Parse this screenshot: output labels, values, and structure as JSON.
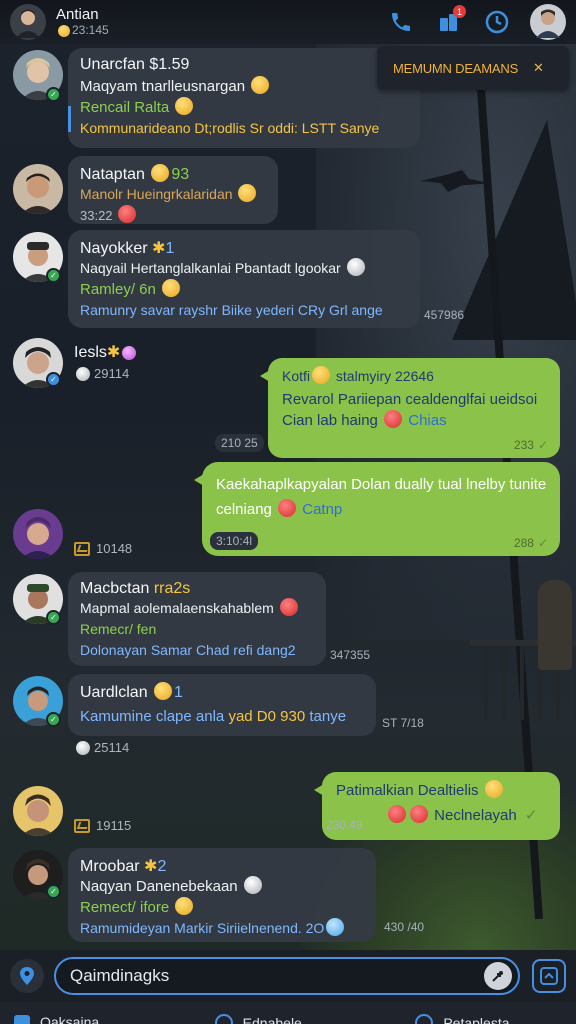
{
  "header": {
    "title": "Antian",
    "subtitle": "23:145",
    "notification_count": "1"
  },
  "banner": {
    "text": "MEMUMN DEAMANS"
  },
  "messages": [
    {
      "name": "Unarcfan $1.59",
      "lines": [
        "Maqyam tnarlleusnargan",
        "Rencail Ralta",
        "Kommunarideano Dt;rodlis Sr oddi: LSTT Sanye"
      ]
    },
    {
      "name": "Nataptan",
      "name_tag": "93",
      "lines": [
        "Manolr Hueingrkalaridan",
        "33:22"
      ]
    },
    {
      "name": "Nayokker",
      "name_tag": "1",
      "lines": [
        "Naqyail Hertanglalkanlai Pbantadt lgookar",
        "Ramley/ 6n",
        "Ramunry savar rayshr Biike yederi CRy Grl ange"
      ],
      "time": "457986"
    },
    {
      "name": "Iesls",
      "meta": "29114"
    },
    {
      "name": "Macbctan",
      "name_tag": "rra2s",
      "lines": [
        "Mapmal aolemalaenskahablem",
        "Remecr/ fen",
        "Dolonayan Samar Chad refi dang2"
      ],
      "time": "347355"
    },
    {
      "name": "Uardlclan",
      "name_tag": "1",
      "lines": [
        "Kamumine clape anla",
        "yad D0 930",
        "tanye"
      ],
      "time": "ST 7/18",
      "meta": "25114"
    },
    {
      "name": "Mroobar",
      "name_tag": "2",
      "lines": [
        "Naqyan Danenebekaan",
        "Remect/ ifore",
        "Ramumideyan Markir Siriielnenend. 2O"
      ],
      "time": "430 /40"
    }
  ],
  "outgoing": [
    {
      "header": "Kotfi",
      "header_rest": "stalmyiry 22646",
      "lines": [
        "Revarol Pariiepan cealdenglfai ueidsoi",
        "Cian lab haing",
        "Chias"
      ],
      "time": "233",
      "side_time": "210 25"
    },
    {
      "lines": [
        "Kaekahaplkapyalan Dolan dually tual lnelby tunite",
        "celniang",
        "Catnp"
      ],
      "time": "288",
      "side_time": "3:10:4l"
    },
    {
      "lines": [
        "Patimalkian Dealtielis",
        "Neclnelayah"
      ],
      "side_time": "230:49"
    }
  ],
  "side_meta": [
    {
      "value": "10148"
    },
    {
      "value": "19115"
    }
  ],
  "composer": {
    "placeholder": "Qaimdinagks"
  },
  "bottom_nav": [
    {
      "label": "Oaksaina"
    },
    {
      "label": "Ednabele"
    },
    {
      "label": "Petaplesta"
    }
  ],
  "colors": {
    "accent": "#4a90e2",
    "outgoing_bubble": "#8bc34a",
    "incoming_bubble": "#343a44",
    "banner_text": "#f0b23a"
  },
  "icons": [
    "phone-icon",
    "puzzle-icon",
    "clock-icon",
    "close-icon",
    "location-icon",
    "mic-icon",
    "send-icon",
    "check-icon"
  ]
}
